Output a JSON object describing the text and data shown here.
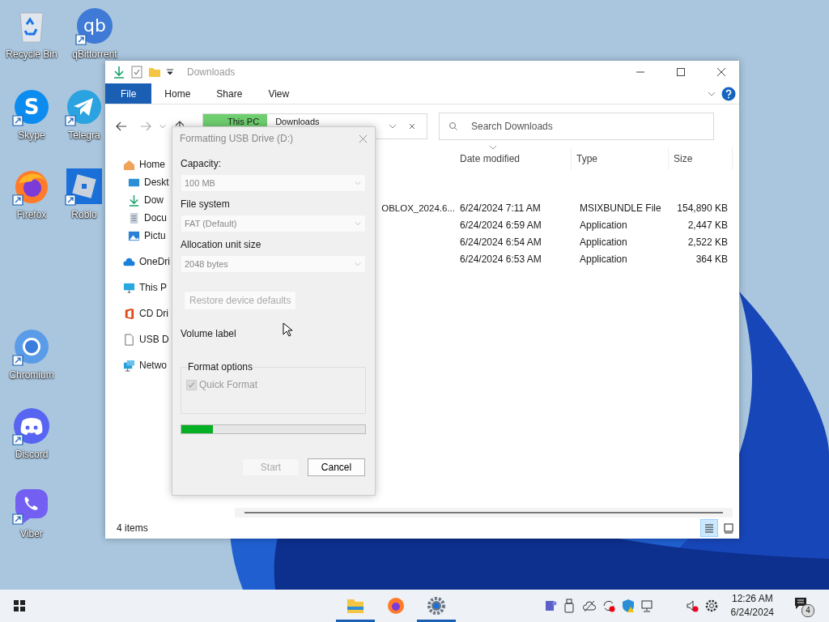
{
  "desktop_icons": [
    {
      "label": "Recycle Bin",
      "kind": "recycle",
      "shortcut": false
    },
    {
      "label": "Skype",
      "kind": "skype",
      "glyph": "S",
      "shortcut": true
    },
    {
      "label": "Firefox",
      "kind": "firefox",
      "shortcut": true
    },
    {
      "label": "Chromium",
      "kind": "chromium",
      "shortcut": true
    },
    {
      "label": "Discord",
      "kind": "discord",
      "shortcut": true
    },
    {
      "label": "Viber",
      "kind": "viber",
      "shortcut": true
    },
    {
      "label": "qBittorrent",
      "kind": "qbittorrent",
      "glyph": "qb",
      "shortcut": true
    },
    {
      "label": "Telegra",
      "kind": "telegram",
      "shortcut": true
    },
    {
      "label": "Roblo",
      "kind": "roblox",
      "shortcut": true
    }
  ],
  "explorer": {
    "title": "Downloads",
    "ribbon_tabs": [
      {
        "label": "File",
        "kind": "file"
      },
      {
        "label": "Home",
        "kind": "tab"
      },
      {
        "label": "Share",
        "kind": "tab"
      },
      {
        "label": "View",
        "kind": "tab"
      }
    ],
    "address": [
      "This PC",
      "Downloads"
    ],
    "search": {
      "placeholder": "Search Downloads"
    },
    "sidebar": [
      {
        "label": "Home",
        "kind": "home",
        "children": [
          {
            "label": "Deskt",
            "kind": "desktop"
          },
          {
            "label": "Dow",
            "kind": "download"
          },
          {
            "label": "Docu",
            "kind": "document"
          },
          {
            "label": "Pictu",
            "kind": "picture"
          }
        ]
      },
      {
        "label": "OneDri",
        "kind": "cloud"
      },
      {
        "label": "This P",
        "kind": "pc"
      },
      {
        "label": "CD Dri",
        "kind": "office"
      },
      {
        "label": "USB D",
        "kind": "file"
      },
      {
        "label": "Netwo",
        "kind": "network"
      }
    ],
    "columns": [
      {
        "label": "Date modified",
        "sorted": true
      },
      {
        "label": "Type",
        "sorted": false
      },
      {
        "label": "Size",
        "sorted": false
      }
    ],
    "rows": [
      {
        "name": "OBLOX_2024.6...",
        "date": "6/24/2024 7:11 AM",
        "type": "MSIXBUNDLE File",
        "size": "154,890 KB"
      },
      {
        "date": "6/24/2024 6:59 AM",
        "type": "Application",
        "size": "2,447 KB"
      },
      {
        "date": "6/24/2024 6:54 AM",
        "type": "Application",
        "size": "2,522 KB"
      },
      {
        "date": "6/24/2024 6:53 AM",
        "type": "Application",
        "size": "364 KB"
      }
    ],
    "status": "4 items",
    "views": [
      {
        "kind": "details",
        "selected": true
      },
      {
        "kind": "tiles",
        "selected": false
      }
    ]
  },
  "dialog": {
    "title": "Formatting USB Drive (D:)",
    "fields": [
      {
        "label": "Capacity:",
        "value": "100 MB",
        "disabled": true
      },
      {
        "label": "File system",
        "value": "FAT (Default)",
        "disabled": true
      },
      {
        "label": "Allocation unit size",
        "value": "2048 bytes",
        "disabled": true
      }
    ],
    "restore_button": {
      "label": "Restore device defaults",
      "disabled": true
    },
    "volume_label": "Volume label",
    "format_options": {
      "title": "Format options",
      "quick_format": {
        "label": "Quick Format",
        "checked": true,
        "disabled": true
      }
    },
    "progress": {
      "level": 0.17
    },
    "buttons": [
      {
        "label": "Start",
        "disabled": true
      },
      {
        "label": "Cancel",
        "disabled": false
      }
    ]
  },
  "taskbar": {
    "apps": [
      {
        "kind": "folder",
        "active": true
      },
      {
        "kind": "firefox",
        "active": false
      },
      {
        "kind": "settings",
        "active": true
      }
    ],
    "tray": [
      {
        "kind": "teams"
      },
      {
        "kind": "usb"
      },
      {
        "kind": "cloud-off"
      },
      {
        "kind": "sync"
      },
      {
        "kind": "shield"
      },
      {
        "kind": "network"
      },
      {
        "kind": "mute"
      },
      {
        "kind": "gear"
      }
    ],
    "time": "12:26 AM",
    "date": "6/24/2024",
    "notifications": "4"
  }
}
